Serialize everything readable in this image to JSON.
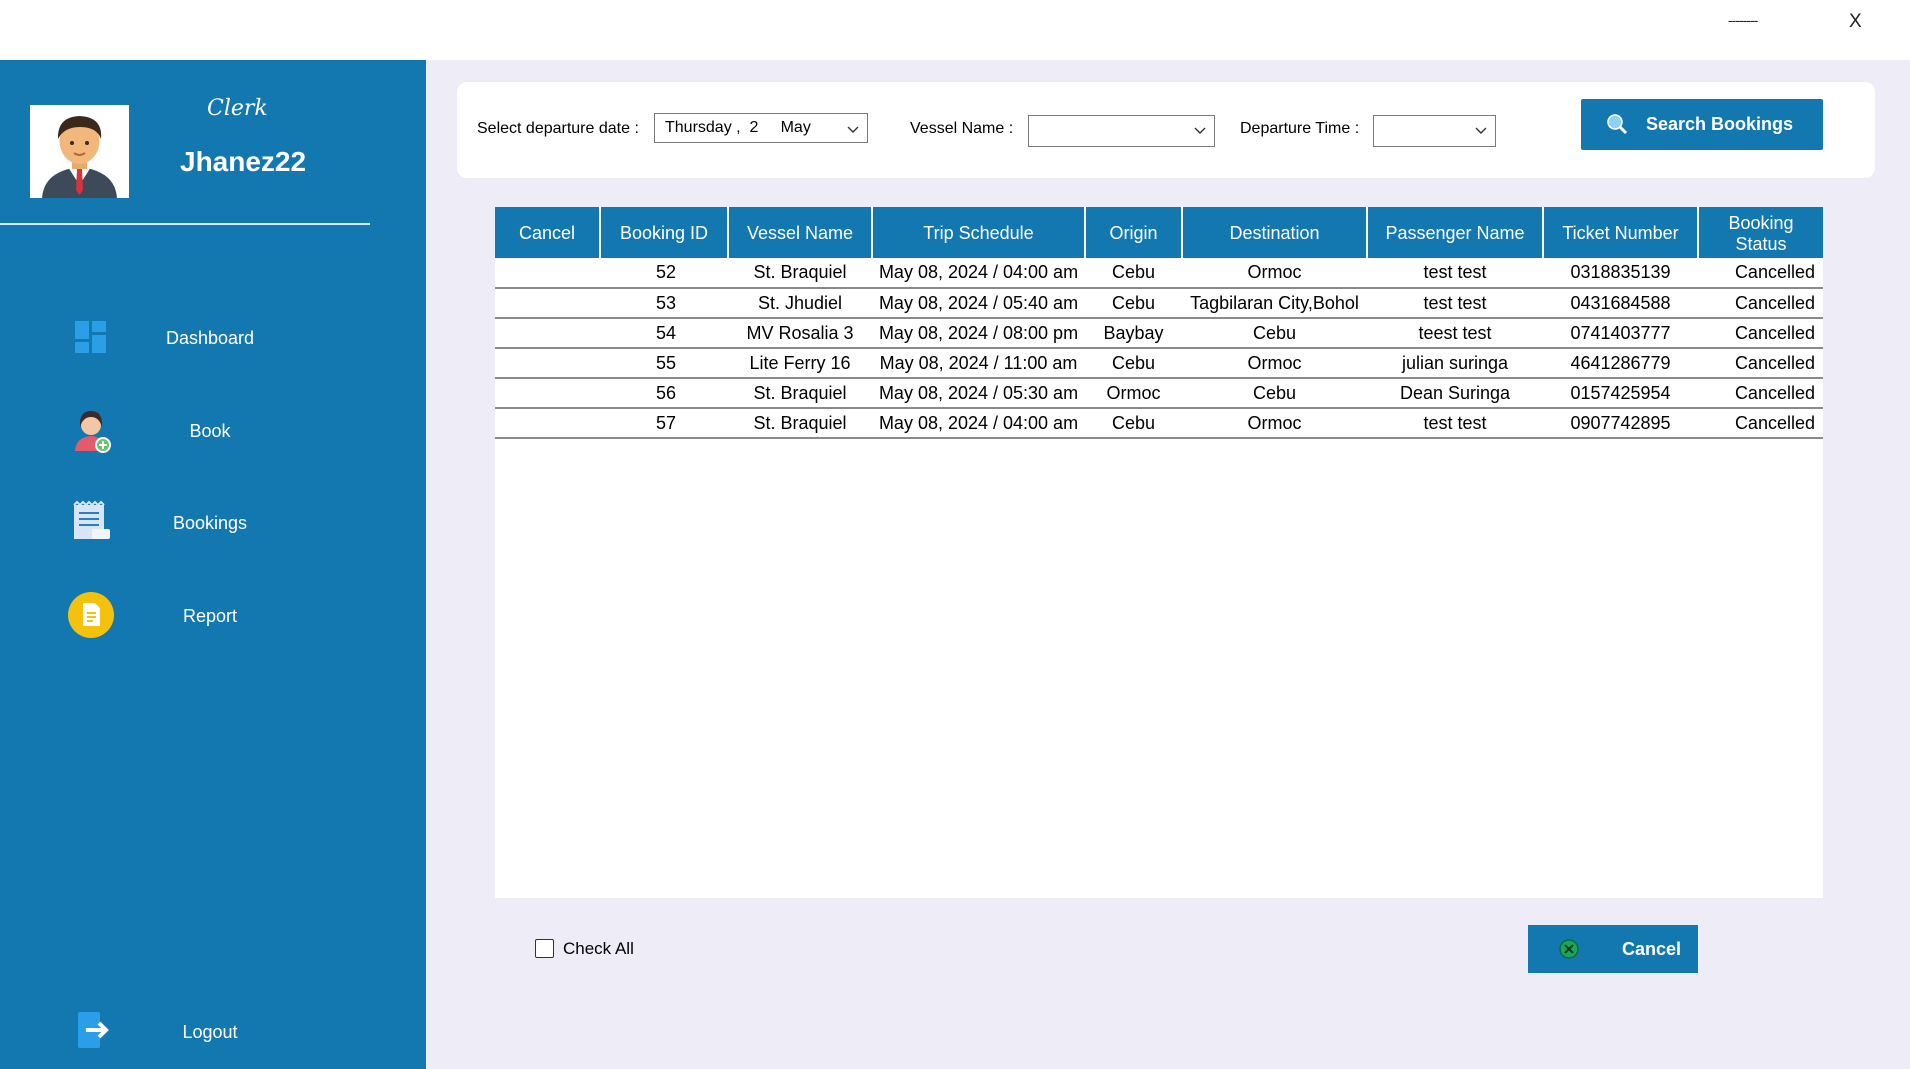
{
  "window": {
    "minimize_label": "--------",
    "close_label": "X"
  },
  "sidebar": {
    "role": "Clerk",
    "username": "Jhanez22",
    "items": [
      {
        "label": "Dashboard",
        "icon": "dashboard-icon"
      },
      {
        "label": "Book",
        "icon": "person-add-icon"
      },
      {
        "label": "Bookings",
        "icon": "ledger-icon"
      },
      {
        "label": "Report",
        "icon": "report-icon"
      }
    ],
    "logout": {
      "label": "Logout",
      "icon": "logout-icon"
    }
  },
  "search": {
    "date_label": "Select departure date :",
    "date_value": "Thursday ,  2     May",
    "vessel_label": "Vessel Name :",
    "vessel_value": "",
    "time_label": "Departure Time :",
    "time_value": "",
    "button_label": "Search Bookings"
  },
  "table": {
    "columns": [
      "Cancel",
      "Booking ID",
      "Vessel Name",
      "Trip Schedule",
      "Origin",
      "Destination",
      "Passenger Name",
      "Ticket Number",
      "Booking Status"
    ],
    "rows": [
      [
        "",
        "52",
        "St. Braquiel",
        "May 08, 2024 / 04:00 am",
        "Cebu",
        "Ormoc",
        "test test",
        "0318835139",
        "Cancelled"
      ],
      [
        "",
        "53",
        "St. Jhudiel",
        "May 08, 2024 / 05:40 am",
        "Cebu",
        "Tagbilaran City,Bohol",
        "test test",
        "0431684588",
        "Cancelled"
      ],
      [
        "",
        "54",
        "MV Rosalia 3",
        "May 08, 2024 / 08:00 pm",
        "Baybay",
        "Cebu",
        "teest test",
        "0741403777",
        "Cancelled"
      ],
      [
        "",
        "55",
        "Lite Ferry 16",
        "May 08, 2024 / 11:00 am",
        "Cebu",
        "Ormoc",
        "julian suringa",
        "4641286779",
        "Cancelled"
      ],
      [
        "",
        "56",
        "St. Braquiel",
        "May 08, 2024 / 05:30 am",
        "Ormoc",
        "Cebu",
        "Dean Suringa",
        "0157425954",
        "Cancelled"
      ],
      [
        "",
        "57",
        "St. Braquiel",
        "May 08, 2024 / 04:00 am",
        "Cebu",
        "Ormoc",
        "test test",
        "0907742895",
        "Cancelled"
      ]
    ]
  },
  "footer": {
    "check_all_label": "Check All",
    "check_all_checked": false,
    "cancel_label": "Cancel"
  },
  "colors": {
    "primary": "#1478b0",
    "background": "#eeedf7",
    "accent_yellow": "#f4c20d"
  }
}
